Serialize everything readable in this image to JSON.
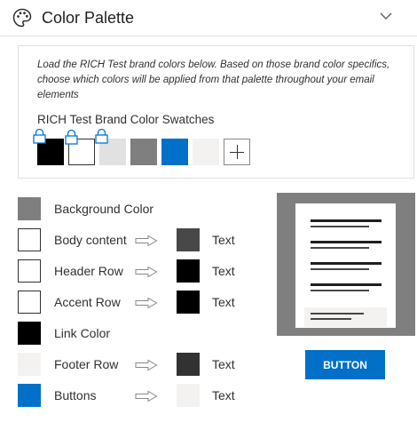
{
  "header": {
    "title": "Color Palette",
    "icon": "palette-icon",
    "collapse_icon": "chevron-down-icon"
  },
  "brand_card": {
    "description": "Load the RICH Test brand colors below. Based on those brand color specifics, choose which colors will be applied from that palette throughout your email elements",
    "swatches_title": "RICH Test Brand Color Swatches",
    "swatches": [
      {
        "color": "#000000",
        "locked": true
      },
      {
        "color": "#ffffff",
        "locked": true
      },
      {
        "color": "#e1e1e1",
        "locked": true
      },
      {
        "color": "#7f7f7f",
        "locked": false
      },
      {
        "color": "#0070c8",
        "locked": false
      },
      {
        "color": "#f3f2f1",
        "locked": false
      }
    ],
    "add_icon": "plus-icon"
  },
  "color_rows": [
    {
      "label": "Background Color",
      "color": "#7f7f7f"
    },
    {
      "label": "Body content",
      "color": "#ffffff",
      "text_label": "Text",
      "text_color": "#484848"
    },
    {
      "label": "Header Row",
      "color": "#ffffff",
      "text_label": "Text",
      "text_color": "#000000"
    },
    {
      "label": "Accent Row",
      "color": "#ffffff",
      "text_label": "Text",
      "text_color": "#000000"
    },
    {
      "label": "Link Color",
      "color": "#000000"
    },
    {
      "label": "Footer Row",
      "color": "#f3f2f1",
      "text_label": "Text",
      "text_color": "#323232"
    },
    {
      "label": "Buttons",
      "color": "#0070c8",
      "text_label": "Text",
      "text_color": "#f3f2f1"
    }
  ],
  "preview": {
    "button_label": "BUTTON",
    "background_color": "#7f7f7f",
    "button_color": "#0070c8"
  }
}
